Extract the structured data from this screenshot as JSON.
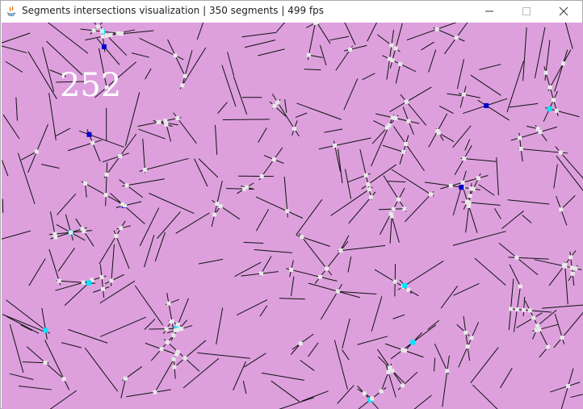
{
  "window": {
    "title": "Segments intersections visualization | 350 segments | 499 fps"
  },
  "overlay": {
    "intersection_count": "252"
  },
  "colors": {
    "canvas_bg": "#dda0dd",
    "segment": "#111111",
    "intersection": "#e8e8e8",
    "highlight_cyan": "#00e5ff",
    "highlight_blue": "#0000cc"
  },
  "icons": [
    "java-icon",
    "minimize-icon",
    "maximize-icon",
    "close-icon"
  ]
}
